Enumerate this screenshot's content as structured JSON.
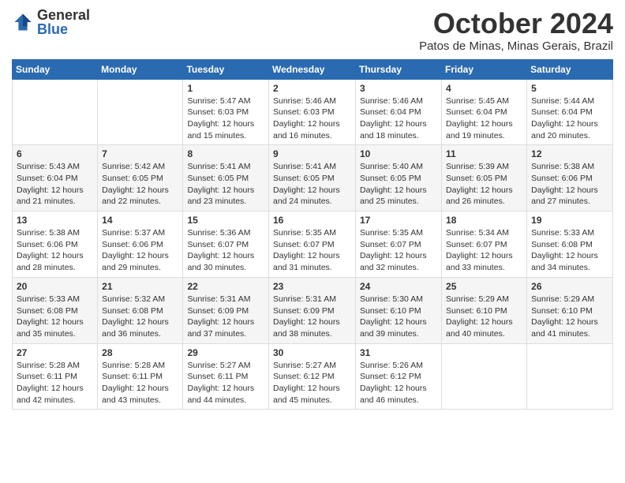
{
  "logo": {
    "general": "General",
    "blue": "Blue"
  },
  "title": {
    "month": "October 2024",
    "location": "Patos de Minas, Minas Gerais, Brazil"
  },
  "headers": [
    "Sunday",
    "Monday",
    "Tuesday",
    "Wednesday",
    "Thursday",
    "Friday",
    "Saturday"
  ],
  "weeks": [
    [
      {
        "day": "",
        "detail": ""
      },
      {
        "day": "",
        "detail": ""
      },
      {
        "day": "1",
        "detail": "Sunrise: 5:47 AM\nSunset: 6:03 PM\nDaylight: 12 hours and 15 minutes."
      },
      {
        "day": "2",
        "detail": "Sunrise: 5:46 AM\nSunset: 6:03 PM\nDaylight: 12 hours and 16 minutes."
      },
      {
        "day": "3",
        "detail": "Sunrise: 5:46 AM\nSunset: 6:04 PM\nDaylight: 12 hours and 18 minutes."
      },
      {
        "day": "4",
        "detail": "Sunrise: 5:45 AM\nSunset: 6:04 PM\nDaylight: 12 hours and 19 minutes."
      },
      {
        "day": "5",
        "detail": "Sunrise: 5:44 AM\nSunset: 6:04 PM\nDaylight: 12 hours and 20 minutes."
      }
    ],
    [
      {
        "day": "6",
        "detail": "Sunrise: 5:43 AM\nSunset: 6:04 PM\nDaylight: 12 hours and 21 minutes."
      },
      {
        "day": "7",
        "detail": "Sunrise: 5:42 AM\nSunset: 6:05 PM\nDaylight: 12 hours and 22 minutes."
      },
      {
        "day": "8",
        "detail": "Sunrise: 5:41 AM\nSunset: 6:05 PM\nDaylight: 12 hours and 23 minutes."
      },
      {
        "day": "9",
        "detail": "Sunrise: 5:41 AM\nSunset: 6:05 PM\nDaylight: 12 hours and 24 minutes."
      },
      {
        "day": "10",
        "detail": "Sunrise: 5:40 AM\nSunset: 6:05 PM\nDaylight: 12 hours and 25 minutes."
      },
      {
        "day": "11",
        "detail": "Sunrise: 5:39 AM\nSunset: 6:05 PM\nDaylight: 12 hours and 26 minutes."
      },
      {
        "day": "12",
        "detail": "Sunrise: 5:38 AM\nSunset: 6:06 PM\nDaylight: 12 hours and 27 minutes."
      }
    ],
    [
      {
        "day": "13",
        "detail": "Sunrise: 5:38 AM\nSunset: 6:06 PM\nDaylight: 12 hours and 28 minutes."
      },
      {
        "day": "14",
        "detail": "Sunrise: 5:37 AM\nSunset: 6:06 PM\nDaylight: 12 hours and 29 minutes."
      },
      {
        "day": "15",
        "detail": "Sunrise: 5:36 AM\nSunset: 6:07 PM\nDaylight: 12 hours and 30 minutes."
      },
      {
        "day": "16",
        "detail": "Sunrise: 5:35 AM\nSunset: 6:07 PM\nDaylight: 12 hours and 31 minutes."
      },
      {
        "day": "17",
        "detail": "Sunrise: 5:35 AM\nSunset: 6:07 PM\nDaylight: 12 hours and 32 minutes."
      },
      {
        "day": "18",
        "detail": "Sunrise: 5:34 AM\nSunset: 6:07 PM\nDaylight: 12 hours and 33 minutes."
      },
      {
        "day": "19",
        "detail": "Sunrise: 5:33 AM\nSunset: 6:08 PM\nDaylight: 12 hours and 34 minutes."
      }
    ],
    [
      {
        "day": "20",
        "detail": "Sunrise: 5:33 AM\nSunset: 6:08 PM\nDaylight: 12 hours and 35 minutes."
      },
      {
        "day": "21",
        "detail": "Sunrise: 5:32 AM\nSunset: 6:08 PM\nDaylight: 12 hours and 36 minutes."
      },
      {
        "day": "22",
        "detail": "Sunrise: 5:31 AM\nSunset: 6:09 PM\nDaylight: 12 hours and 37 minutes."
      },
      {
        "day": "23",
        "detail": "Sunrise: 5:31 AM\nSunset: 6:09 PM\nDaylight: 12 hours and 38 minutes."
      },
      {
        "day": "24",
        "detail": "Sunrise: 5:30 AM\nSunset: 6:10 PM\nDaylight: 12 hours and 39 minutes."
      },
      {
        "day": "25",
        "detail": "Sunrise: 5:29 AM\nSunset: 6:10 PM\nDaylight: 12 hours and 40 minutes."
      },
      {
        "day": "26",
        "detail": "Sunrise: 5:29 AM\nSunset: 6:10 PM\nDaylight: 12 hours and 41 minutes."
      }
    ],
    [
      {
        "day": "27",
        "detail": "Sunrise: 5:28 AM\nSunset: 6:11 PM\nDaylight: 12 hours and 42 minutes."
      },
      {
        "day": "28",
        "detail": "Sunrise: 5:28 AM\nSunset: 6:11 PM\nDaylight: 12 hours and 43 minutes."
      },
      {
        "day": "29",
        "detail": "Sunrise: 5:27 AM\nSunset: 6:11 PM\nDaylight: 12 hours and 44 minutes."
      },
      {
        "day": "30",
        "detail": "Sunrise: 5:27 AM\nSunset: 6:12 PM\nDaylight: 12 hours and 45 minutes."
      },
      {
        "day": "31",
        "detail": "Sunrise: 5:26 AM\nSunset: 6:12 PM\nDaylight: 12 hours and 46 minutes."
      },
      {
        "day": "",
        "detail": ""
      },
      {
        "day": "",
        "detail": ""
      }
    ]
  ]
}
